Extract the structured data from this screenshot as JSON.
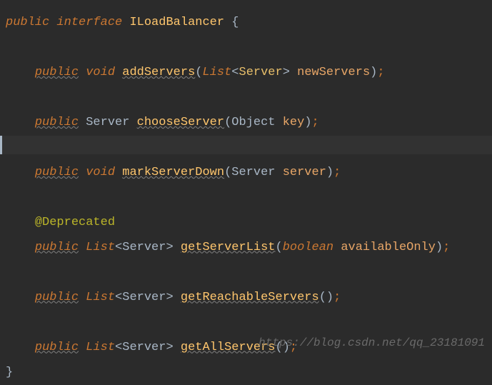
{
  "code": {
    "public": "public",
    "interface": "interface",
    "void": "void",
    "boolean": "boolean",
    "classname": "ILoadBalancer",
    "lbrace": "{",
    "rbrace": "}",
    "lparen": "(",
    "rparen": ")",
    "lt": "<",
    "gt": ">",
    "semi": ";",
    "List": "List",
    "Server": "Server",
    "Object": "Object",
    "addServers": "addServers",
    "chooseServer": "chooseServer",
    "markServerDown": "markServerDown",
    "getServerList": "getServerList",
    "getReachableServers": "getReachableServers",
    "getAllServers": "getAllServers",
    "newServers": "newServers",
    "key": "key",
    "server": "server",
    "availableOnly": "availableOnly",
    "Deprecated": "@Deprecated"
  },
  "watermark": "https://blog.csdn.net/qq_23181091"
}
